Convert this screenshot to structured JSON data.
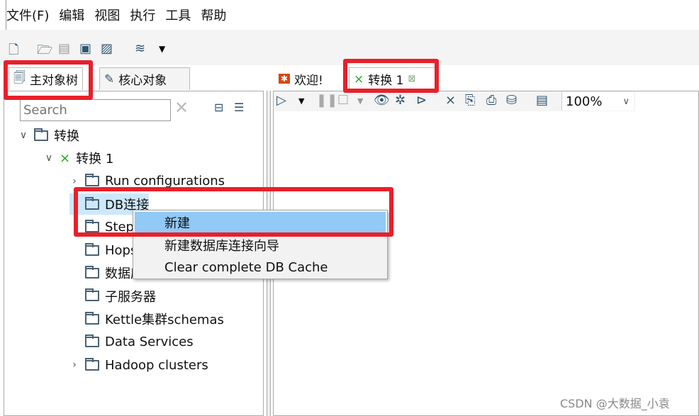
{
  "menubar": [
    "文件(F)",
    "编辑",
    "视图",
    "执行",
    "工具",
    "帮助"
  ],
  "left_tabs": [
    "主对象树",
    "核心对象"
  ],
  "search": {
    "placeholder": "Search",
    "value": ""
  },
  "tree": [
    {
      "label": "转换",
      "level": 0,
      "expanded": true
    },
    {
      "label": "转换 1",
      "level": 1,
      "expanded": true
    },
    {
      "label": "Run configurations",
      "level": 2,
      "expandable": true
    },
    {
      "label": "DB连接",
      "level": 2,
      "selected": true
    },
    {
      "label": "Steps",
      "level": 2
    },
    {
      "label": "Hops",
      "level": 2
    },
    {
      "label": "数据库分区schemas",
      "level": 2
    },
    {
      "label": "子服务器",
      "level": 2
    },
    {
      "label": "Kettle集群schemas",
      "level": 2
    },
    {
      "label": "Data Services",
      "level": 2
    },
    {
      "label": "Hadoop clusters",
      "level": 2,
      "expandable": true
    }
  ],
  "editor_tabs": [
    {
      "label": "欢迎!"
    },
    {
      "label": "转换 1",
      "active": true
    }
  ],
  "zoom": "100%",
  "context_menu": [
    {
      "label": "新建",
      "highlighted": true
    },
    {
      "label": "新建数据库连接向导"
    },
    {
      "label": "Clear complete DB Cache"
    }
  ],
  "watermark": "CSDN @大数据_小袁",
  "colors": {
    "highlight": "#91c9f7",
    "annotation": "#e8202a",
    "selected": "#cce8ff"
  }
}
